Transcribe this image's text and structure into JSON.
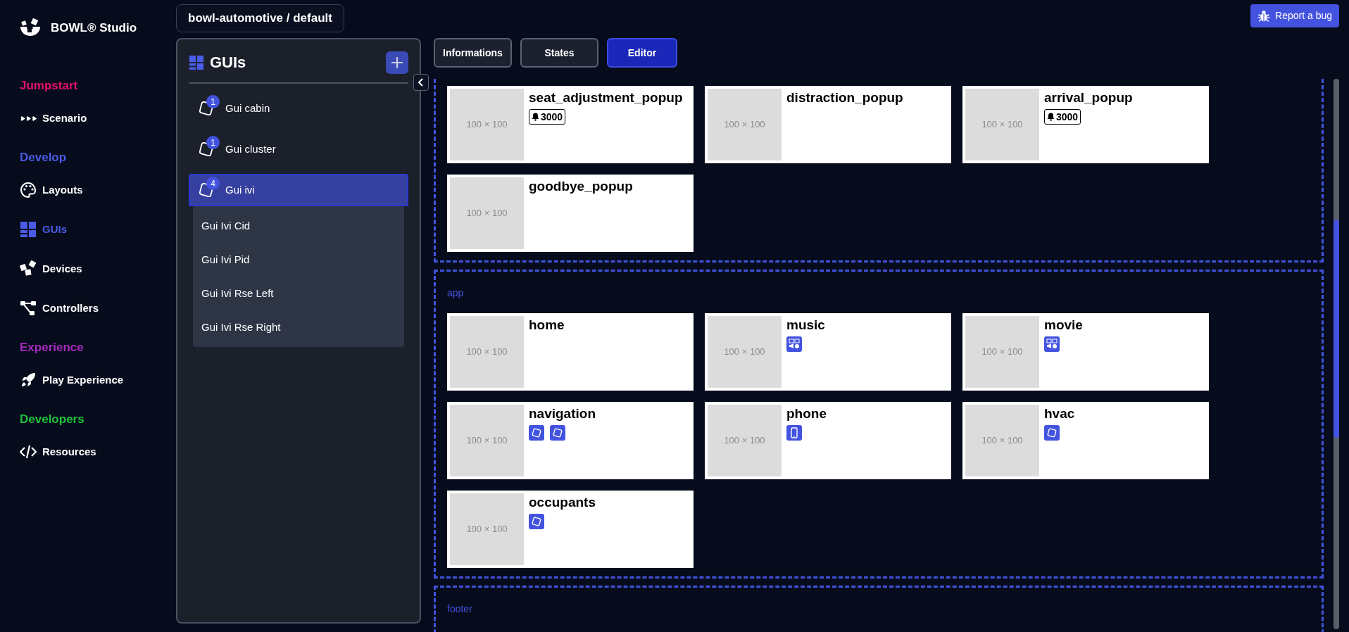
{
  "brand": {
    "name": "BOWL® Studio"
  },
  "sidebar": {
    "sections": [
      {
        "title": "Jumpstart",
        "color": "#e8106c",
        "items": [
          {
            "label": "Scenario",
            "kind": "scenario",
            "selected": false
          }
        ]
      },
      {
        "title": "Develop",
        "color": "#4a5be6",
        "items": [
          {
            "label": "Layouts",
            "kind": "palette",
            "selected": false
          },
          {
            "label": "GUIs",
            "kind": "grid",
            "selected": true
          },
          {
            "label": "Devices",
            "kind": "cubes",
            "selected": false
          },
          {
            "label": "Controllers",
            "kind": "network",
            "selected": false
          }
        ]
      },
      {
        "title": "Experience",
        "color": "#a52ac0",
        "items": [
          {
            "label": "Play Experience",
            "kind": "rocket",
            "selected": false
          }
        ]
      },
      {
        "title": "Developers",
        "color": "#1dc43a",
        "items": [
          {
            "label": "Resources",
            "kind": "code",
            "selected": false
          }
        ]
      }
    ]
  },
  "breadcrumb": "bowl-automotive / default",
  "report_button": "Report a bug",
  "panel": {
    "title": "GUIs",
    "items": [
      {
        "label": "Gui cabin",
        "count": "1",
        "selected": false
      },
      {
        "label": "Gui cluster",
        "count": "1",
        "selected": false
      },
      {
        "label": "Gui ivi",
        "count": "4",
        "selected": true,
        "expanded": true,
        "children": [
          {
            "label": "Gui Ivi Cid"
          },
          {
            "label": "Gui Ivi Pid"
          },
          {
            "label": "Gui Ivi Rse Left"
          },
          {
            "label": "Gui Ivi Rse Right"
          }
        ]
      }
    ]
  },
  "tabs": [
    {
      "label": "Informations",
      "selected": false
    },
    {
      "label": "States",
      "selected": false
    },
    {
      "label": "Editor",
      "selected": true
    }
  ],
  "sections": [
    {
      "cards": [
        {
          "title": "seat_adjustment_popup",
          "image_label": "100 × 100",
          "badges": [
            {
              "kind": "notification",
              "text": "3000"
            }
          ]
        },
        {
          "title": "distraction_popup",
          "image_label": "100 × 100"
        },
        {
          "title": "arrival_popup",
          "image_label": "100 × 100",
          "badges": [
            {
              "kind": "notification",
              "text": "3000"
            }
          ]
        },
        {
          "title": "goodbye_popup",
          "image_label": "100 × 100"
        }
      ]
    },
    {
      "label": "app",
      "cards": [
        {
          "title": "home",
          "image_label": "100 × 100"
        },
        {
          "title": "music",
          "image_label": "100 × 100",
          "badges": [
            {
              "kind": "media"
            }
          ]
        },
        {
          "title": "movie",
          "image_label": "100 × 100",
          "badges": [
            {
              "kind": "media"
            }
          ]
        },
        {
          "title": "navigation",
          "image_label": "100 × 100",
          "badges": [
            {
              "kind": "device"
            },
            {
              "kind": "device"
            }
          ]
        },
        {
          "title": "phone",
          "image_label": "100 × 100",
          "badges": [
            {
              "kind": "phone"
            }
          ]
        },
        {
          "title": "hvac",
          "image_label": "100 × 100",
          "badges": [
            {
              "kind": "device"
            }
          ]
        },
        {
          "title": "occupants",
          "image_label": "100 × 100",
          "badges": [
            {
              "kind": "device"
            }
          ]
        }
      ]
    },
    {
      "label": "footer"
    }
  ]
}
